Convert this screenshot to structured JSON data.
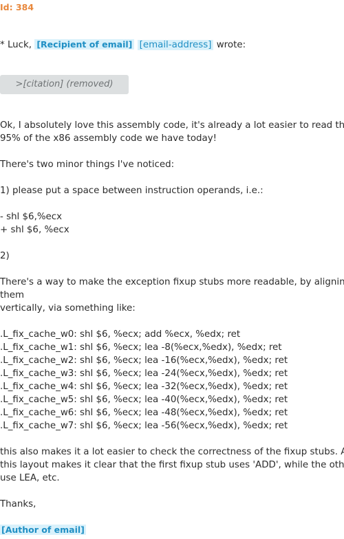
{
  "email": {
    "id": "Id: 384",
    "quote_prefix": "* Luck,",
    "recipient_tag": "[Recipient of email]",
    "address_tag": "[email-address]",
    "wrote": "wrote:",
    "citation": ">[citation] (removed)",
    "body": {
      "p1_l1": "Ok, I absolutely love this assembly code, it's already a lot easier to read than",
      "p1_l2": "95% of the x86 assembly code we have today!",
      "p2": "There's two minor things I've noticed:",
      "p3": "1) please put a space between instruction operands, i.e.:",
      "diff_minus": "- shl $6,%ecx",
      "diff_plus": "+ shl $6, %ecx",
      "p4": "2)",
      "p5_l1": "There's a way to make the exception fixup stubs more readable, by aligning",
      "p5_l2": "them",
      "p5_l3": "vertically, via something like:",
      "code": [
        ".L_fix_cache_w0: shl $6, %ecx; add %ecx, %edx; ret",
        ".L_fix_cache_w1: shl $6, %ecx; lea -8(%ecx,%edx), %edx; ret",
        ".L_fix_cache_w2: shl $6, %ecx; lea -16(%ecx,%edx), %edx; ret",
        ".L_fix_cache_w3: shl $6, %ecx; lea -24(%ecx,%edx), %edx; ret",
        ".L_fix_cache_w4: shl $6, %ecx; lea -32(%ecx,%edx), %edx; ret",
        ".L_fix_cache_w5: shl $6, %ecx; lea -40(%ecx,%edx), %edx; ret",
        ".L_fix_cache_w6: shl $6, %ecx; lea -48(%ecx,%edx), %edx; ret",
        ".L_fix_cache_w7: shl $6, %ecx; lea -56(%ecx,%edx), %edx; ret"
      ],
      "p6_l1": "this also makes it a lot easier to check the correctness of the fixup stubs. Also",
      "p6_l2": "this layout makes it clear that the first fixup stub uses 'ADD', while the others",
      "p6_l3": "use LEA, etc.",
      "closing": "Thanks,"
    },
    "author_tag": "[Author of email]"
  }
}
